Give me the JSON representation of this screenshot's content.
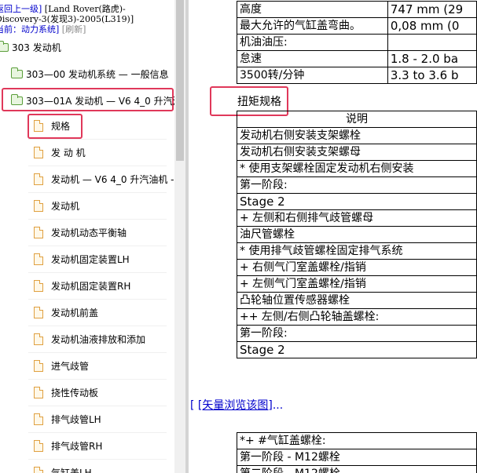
{
  "sidebar": {
    "header": {
      "back_link": "返回上一级]",
      "title_line1": "[Land Rover(路虎)-",
      "title_line2": "Discovery-3(发现3)-2005(L319)]",
      "current_label": "当前：",
      "current_value": "动力系统]",
      "refresh": "[刷新]"
    },
    "tree": [
      {
        "label": "303 发动机",
        "icon": "folder-icon"
      },
      {
        "label": "303—00 发动机系统 — 一般信息",
        "icon": "folder-icon"
      },
      {
        "label": "303—01A 发动机 — V6 4_0 升汽油机",
        "icon": "folder-open-icon"
      }
    ],
    "leaves": [
      "规格",
      "发 动 机",
      "发动机 — V6 4_0 升汽油机 -",
      "发动机",
      "发动机动态平衡轴",
      "发动机固定装置LH",
      "发动机固定装置RH",
      "发动机前盖",
      "发动机油液排放和添加",
      "进气歧管",
      "挠性传动板",
      "排气歧管LH",
      "排气歧管RH",
      "气缸盖LH"
    ]
  },
  "content": {
    "top_table": [
      {
        "label": "高度",
        "value": "747 mm (29"
      },
      {
        "label": "最大允许的气缸盖弯曲。",
        "value": "0,08 mm (0"
      },
      {
        "label": "机油油压:",
        "value": ""
      },
      {
        "label": "怠速",
        "value": "1.8 - 2.0 ba"
      },
      {
        "label": "3500转/分钟",
        "value": "3.3 to 3.6 b"
      }
    ],
    "heading": "扭矩规格",
    "torque_header": "说明",
    "torque_rows": [
      "发动机右侧安装支架螺栓",
      "发动机右侧安装支架螺母",
      "* 使用支架螺栓固定发动机右侧安装",
      "第一阶段:",
      "Stage 2",
      "+ 左侧和右侧排气歧管螺母",
      "油尺管螺栓",
      "* 使用排气歧管螺栓固定排气系统",
      "+ 右侧气门室盖螺栓/指销",
      "+ 左侧气门室盖螺栓/指销",
      "凸轮轴位置传感器螺栓",
      "++ 左侧/右侧凸轮轴盖螺栓:",
      "第一阶段:",
      "Stage 2"
    ],
    "vector_link_prefix": "[",
    "vector_link": "[矢量浏览该图]",
    "vector_link_suffix": "...",
    "bottom_rows": [
      "*+ #气缸盖螺栓:",
      "第一阶段 - M12螺栓",
      "第二阶段 - M12螺栓"
    ]
  },
  "colors": {
    "highlight": "#e0385a",
    "link": "#0000cc",
    "folder": "#5a9e3a",
    "page": "#e0a040"
  }
}
